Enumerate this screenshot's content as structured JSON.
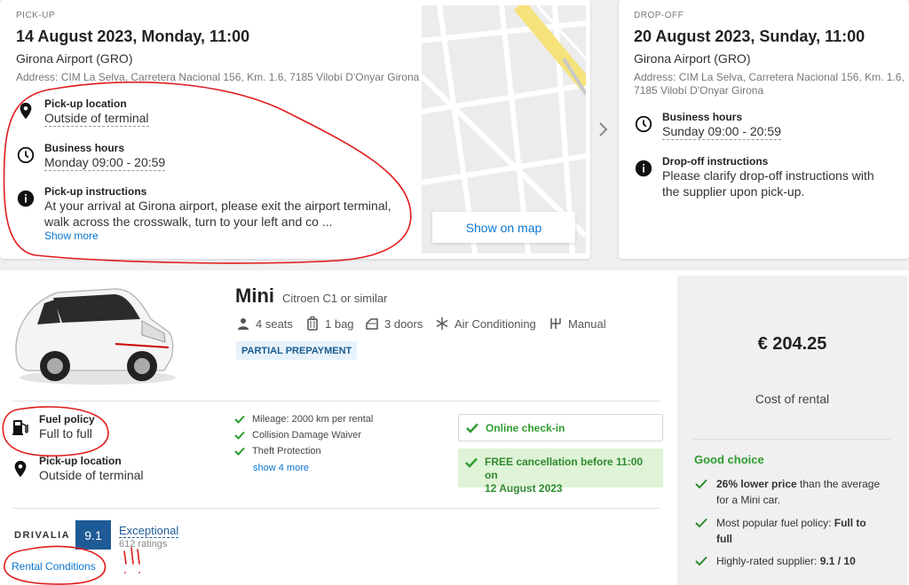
{
  "pickup": {
    "label": "PICK-UP",
    "datetime": "14 August 2023, Monday, 11:00",
    "airport": "Girona Airport (GRO)",
    "address": "Address: CIM La Selva, Carretera Nacional 156, Km. 1.6, 7185 Vilobí D'Onyar Girona",
    "location_title": "Pick-up location",
    "location_value": "Outside of terminal",
    "hours_title": "Business hours",
    "hours_value": "Monday 09:00 - 20:59",
    "instructions_title": "Pick-up instructions",
    "instructions_line1": "At your arrival at Girona airport, please exit the airport terminal,",
    "instructions_line2": "walk across the crosswalk, turn to your left and co ...",
    "show_more": "Show more",
    "show_on_map": "Show on map"
  },
  "dropoff": {
    "label": "DROP-OFF",
    "datetime": "20 August 2023, Sunday, 11:00",
    "airport": "Girona Airport (GRO)",
    "address_line1": "Address: CIM La Selva, Carretera Nacional 156, Km. 1.6,",
    "address_line2": "7185 Vilobí D'Onyar Girona",
    "hours_title": "Business hours",
    "hours_value": "Sunday 09:00 - 20:59",
    "instructions_title": "Drop-off instructions",
    "instructions_line1": "Please clarify drop-off instructions with",
    "instructions_line2": "the supplier upon pick-up."
  },
  "car": {
    "name": "Mini",
    "model": "Citroen C1 or similar",
    "features": {
      "seats": "4 seats",
      "bags": "1 bag",
      "doors": "3 doors",
      "ac": "Air Conditioning",
      "transmission": "Manual"
    },
    "badge": "PARTIAL PREPAYMENT",
    "fuel_title": "Fuel policy",
    "fuel_value": "Full to full",
    "pickup_title": "Pick-up location",
    "pickup_value": "Outside of terminal",
    "inclusions": [
      "Mileage: 2000 km per rental",
      "Collision Damage Waiver",
      "Theft Protection"
    ],
    "show_more": "show 4 more",
    "checkin": "Online check-in",
    "cancel_line1": "FREE cancellation before 11:00 on",
    "cancel_line2": "12 August 2023",
    "supplier": "DRIVALIA",
    "score": "9.1",
    "rating_label": "Exceptional",
    "ratings_count": "612 ratings",
    "rental_conditions": "Rental Conditions"
  },
  "price": {
    "amount": "€ 204.25",
    "label": "Cost of rental",
    "good_choice": "Good choice",
    "reason1_bold": "26% lower price",
    "reason1_rest": " than the average",
    "reason1_line2": "for a Mini car.",
    "reason2_text": "Most popular fuel policy: ",
    "reason2_bold": "Full to",
    "reason2_bold2": "full",
    "reason3_text": "Highly-rated supplier: ",
    "reason3_bold": "9.1 / 10"
  },
  "colors": {
    "accent_blue": "#0a76d0",
    "success_green": "#2e9c2e",
    "score_blue": "#1e5a96",
    "annotation_red": "#e01b1b"
  }
}
